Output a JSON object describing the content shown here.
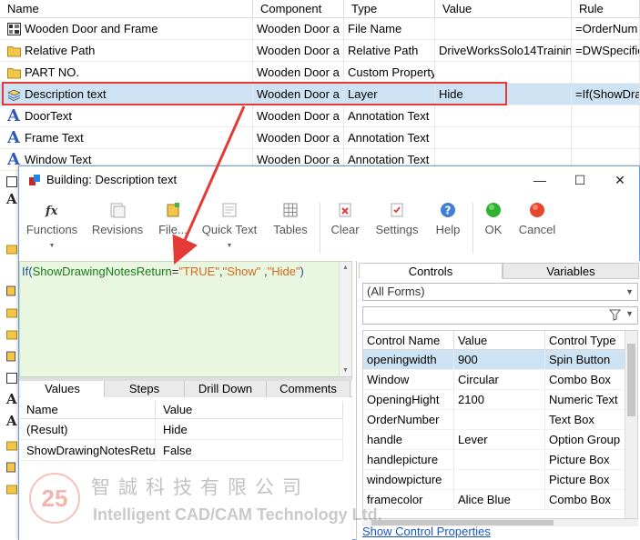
{
  "background_table": {
    "headers": [
      "Name",
      "Component",
      "Type",
      "Value",
      "Rule"
    ],
    "rows": [
      {
        "icon": "table-icon",
        "name": "Wooden Door and Frame",
        "component": "Wooden Door a",
        "type": "File Name",
        "value": "",
        "rule": "=OrderNum"
      },
      {
        "icon": "folder-icon",
        "name": "Relative Path",
        "component": "Wooden Door a",
        "type": "Relative Path",
        "value": "DriveWorksSolo14Trainin",
        "rule": "=DWSpecific"
      },
      {
        "icon": "folder-icon",
        "name": "PART NO.",
        "component": "Wooden Door a",
        "type": "Custom Property",
        "value": "",
        "rule": ""
      },
      {
        "icon": "layer-icon",
        "name": "Description text",
        "component": "Wooden Door a",
        "type": "Layer",
        "value": "Hide",
        "rule": "=If(ShowDra"
      },
      {
        "icon": "annotation-a-icon",
        "name": "DoorText",
        "component": "Wooden Door a",
        "type": "Annotation Text",
        "value": "",
        "rule": ""
      },
      {
        "icon": "annotation-a-icon",
        "name": "Frame Text",
        "component": "Wooden Door a",
        "type": "Annotation Text",
        "value": "",
        "rule": ""
      },
      {
        "icon": "annotation-a-icon",
        "name": "Window Text",
        "component": "Wooden Door a",
        "type": "Annotation Text",
        "value": "",
        "rule": ""
      }
    ]
  },
  "dialog": {
    "title": "Building: Description text",
    "window_buttons": {
      "minimize": "—",
      "maximize": "☐",
      "close": "✕"
    },
    "ribbon": [
      {
        "label": "Functions",
        "icon": "fx-icon",
        "dropdown": true
      },
      {
        "label": "Revisions",
        "icon": "revisions-icon",
        "dropdown": false
      },
      {
        "label": "File...",
        "icon": "file-icon",
        "dropdown": false
      },
      {
        "label": "Quick Text",
        "icon": "quick-text-icon",
        "dropdown": true
      },
      {
        "label": "Tables",
        "icon": "tables-icon",
        "dropdown": false
      },
      {
        "label": "Clear",
        "icon": "clear-icon",
        "dropdown": false
      },
      {
        "label": "Settings",
        "icon": "settings-icon",
        "dropdown": false
      },
      {
        "label": "Help",
        "icon": "help-icon",
        "dropdown": false
      },
      {
        "label": "OK",
        "icon": "ok-icon",
        "dropdown": false
      },
      {
        "label": "Cancel",
        "icon": "cancel-icon",
        "dropdown": false
      }
    ],
    "formula": {
      "fn": "If(",
      "arg": "ShowDrawingNotesReturn",
      "op": "=",
      "str1": "\"TRUE\"",
      "comma1": ",",
      "str2": "\"Show\"",
      "comma2": " ,",
      "str3": "\"Hide\"",
      "close": ")"
    },
    "bottom_tabs": [
      "Values",
      "Steps",
      "Drill Down",
      "Comments"
    ],
    "values_table": {
      "headers": [
        "Name",
        "Value"
      ],
      "rows": [
        {
          "name": "(Result)",
          "value": "Hide"
        },
        {
          "name": "ShowDrawingNotesReturn",
          "value": "False"
        }
      ]
    },
    "right_tabs": [
      "Controls",
      "Variables"
    ],
    "forms_combo": "(All Forms)",
    "controls_table": {
      "headers": [
        "Control Name",
        "Value",
        "Control Type"
      ],
      "rows": [
        {
          "name": "openingwidth",
          "value": "900",
          "type": "Spin Button"
        },
        {
          "name": "Window",
          "value": "Circular",
          "type": "Combo Box"
        },
        {
          "name": "OpeningHight",
          "value": "2100",
          "type": "Numeric Text"
        },
        {
          "name": "OrderNumber",
          "value": "",
          "type": "Text Box"
        },
        {
          "name": "handle",
          "value": "Lever",
          "type": "Option Group"
        },
        {
          "name": "handlepicture",
          "value": "",
          "type": "Picture Box"
        },
        {
          "name": "windowpicture",
          "value": "",
          "type": "Picture Box"
        },
        {
          "name": "framecolor",
          "value": "Alice Blue",
          "type": "Combo Box"
        }
      ]
    },
    "show_props_link": "Show Control Properties"
  },
  "watermark": {
    "logo_text": "25",
    "chinese": "智誠科技有限公司",
    "english": "Intelligent CAD/CAM Technology Ltd."
  },
  "colors": {
    "highlight_border": "#e53935",
    "selection": "#cde3f3",
    "formula_bg": "#e9f6e0",
    "link": "#1a55c8"
  }
}
